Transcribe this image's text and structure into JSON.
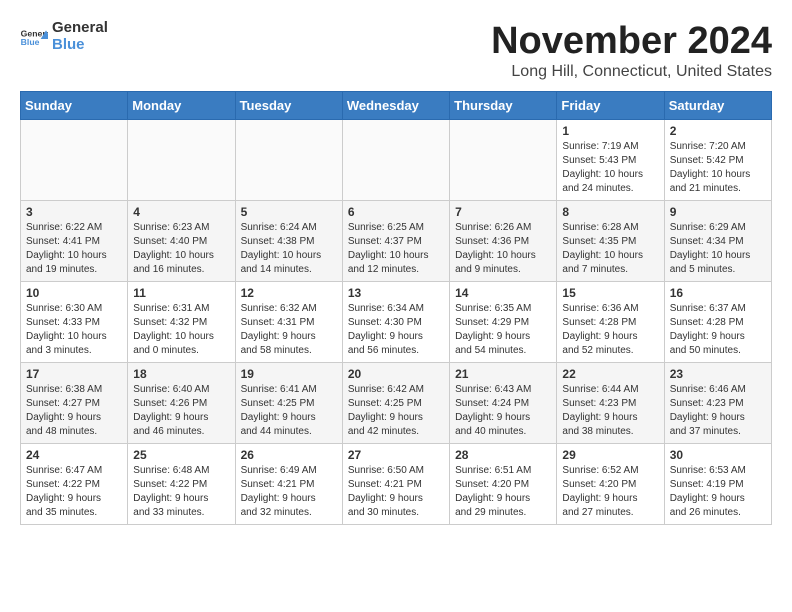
{
  "header": {
    "logo_general": "General",
    "logo_blue": "Blue",
    "month_title": "November 2024",
    "location": "Long Hill, Connecticut, United States"
  },
  "weekdays": [
    "Sunday",
    "Monday",
    "Tuesday",
    "Wednesday",
    "Thursday",
    "Friday",
    "Saturday"
  ],
  "weeks": [
    [
      {
        "day": "",
        "detail": ""
      },
      {
        "day": "",
        "detail": ""
      },
      {
        "day": "",
        "detail": ""
      },
      {
        "day": "",
        "detail": ""
      },
      {
        "day": "",
        "detail": ""
      },
      {
        "day": "1",
        "detail": "Sunrise: 7:19 AM\nSunset: 5:43 PM\nDaylight: 10 hours\nand 24 minutes."
      },
      {
        "day": "2",
        "detail": "Sunrise: 7:20 AM\nSunset: 5:42 PM\nDaylight: 10 hours\nand 21 minutes."
      }
    ],
    [
      {
        "day": "3",
        "detail": "Sunrise: 6:22 AM\nSunset: 4:41 PM\nDaylight: 10 hours\nand 19 minutes."
      },
      {
        "day": "4",
        "detail": "Sunrise: 6:23 AM\nSunset: 4:40 PM\nDaylight: 10 hours\nand 16 minutes."
      },
      {
        "day": "5",
        "detail": "Sunrise: 6:24 AM\nSunset: 4:38 PM\nDaylight: 10 hours\nand 14 minutes."
      },
      {
        "day": "6",
        "detail": "Sunrise: 6:25 AM\nSunset: 4:37 PM\nDaylight: 10 hours\nand 12 minutes."
      },
      {
        "day": "7",
        "detail": "Sunrise: 6:26 AM\nSunset: 4:36 PM\nDaylight: 10 hours\nand 9 minutes."
      },
      {
        "day": "8",
        "detail": "Sunrise: 6:28 AM\nSunset: 4:35 PM\nDaylight: 10 hours\nand 7 minutes."
      },
      {
        "day": "9",
        "detail": "Sunrise: 6:29 AM\nSunset: 4:34 PM\nDaylight: 10 hours\nand 5 minutes."
      }
    ],
    [
      {
        "day": "10",
        "detail": "Sunrise: 6:30 AM\nSunset: 4:33 PM\nDaylight: 10 hours\nand 3 minutes."
      },
      {
        "day": "11",
        "detail": "Sunrise: 6:31 AM\nSunset: 4:32 PM\nDaylight: 10 hours\nand 0 minutes."
      },
      {
        "day": "12",
        "detail": "Sunrise: 6:32 AM\nSunset: 4:31 PM\nDaylight: 9 hours\nand 58 minutes."
      },
      {
        "day": "13",
        "detail": "Sunrise: 6:34 AM\nSunset: 4:30 PM\nDaylight: 9 hours\nand 56 minutes."
      },
      {
        "day": "14",
        "detail": "Sunrise: 6:35 AM\nSunset: 4:29 PM\nDaylight: 9 hours\nand 54 minutes."
      },
      {
        "day": "15",
        "detail": "Sunrise: 6:36 AM\nSunset: 4:28 PM\nDaylight: 9 hours\nand 52 minutes."
      },
      {
        "day": "16",
        "detail": "Sunrise: 6:37 AM\nSunset: 4:28 PM\nDaylight: 9 hours\nand 50 minutes."
      }
    ],
    [
      {
        "day": "17",
        "detail": "Sunrise: 6:38 AM\nSunset: 4:27 PM\nDaylight: 9 hours\nand 48 minutes."
      },
      {
        "day": "18",
        "detail": "Sunrise: 6:40 AM\nSunset: 4:26 PM\nDaylight: 9 hours\nand 46 minutes."
      },
      {
        "day": "19",
        "detail": "Sunrise: 6:41 AM\nSunset: 4:25 PM\nDaylight: 9 hours\nand 44 minutes."
      },
      {
        "day": "20",
        "detail": "Sunrise: 6:42 AM\nSunset: 4:25 PM\nDaylight: 9 hours\nand 42 minutes."
      },
      {
        "day": "21",
        "detail": "Sunrise: 6:43 AM\nSunset: 4:24 PM\nDaylight: 9 hours\nand 40 minutes."
      },
      {
        "day": "22",
        "detail": "Sunrise: 6:44 AM\nSunset: 4:23 PM\nDaylight: 9 hours\nand 38 minutes."
      },
      {
        "day": "23",
        "detail": "Sunrise: 6:46 AM\nSunset: 4:23 PM\nDaylight: 9 hours\nand 37 minutes."
      }
    ],
    [
      {
        "day": "24",
        "detail": "Sunrise: 6:47 AM\nSunset: 4:22 PM\nDaylight: 9 hours\nand 35 minutes."
      },
      {
        "day": "25",
        "detail": "Sunrise: 6:48 AM\nSunset: 4:22 PM\nDaylight: 9 hours\nand 33 minutes."
      },
      {
        "day": "26",
        "detail": "Sunrise: 6:49 AM\nSunset: 4:21 PM\nDaylight: 9 hours\nand 32 minutes."
      },
      {
        "day": "27",
        "detail": "Sunrise: 6:50 AM\nSunset: 4:21 PM\nDaylight: 9 hours\nand 30 minutes."
      },
      {
        "day": "28",
        "detail": "Sunrise: 6:51 AM\nSunset: 4:20 PM\nDaylight: 9 hours\nand 29 minutes."
      },
      {
        "day": "29",
        "detail": "Sunrise: 6:52 AM\nSunset: 4:20 PM\nDaylight: 9 hours\nand 27 minutes."
      },
      {
        "day": "30",
        "detail": "Sunrise: 6:53 AM\nSunset: 4:19 PM\nDaylight: 9 hours\nand 26 minutes."
      }
    ]
  ]
}
